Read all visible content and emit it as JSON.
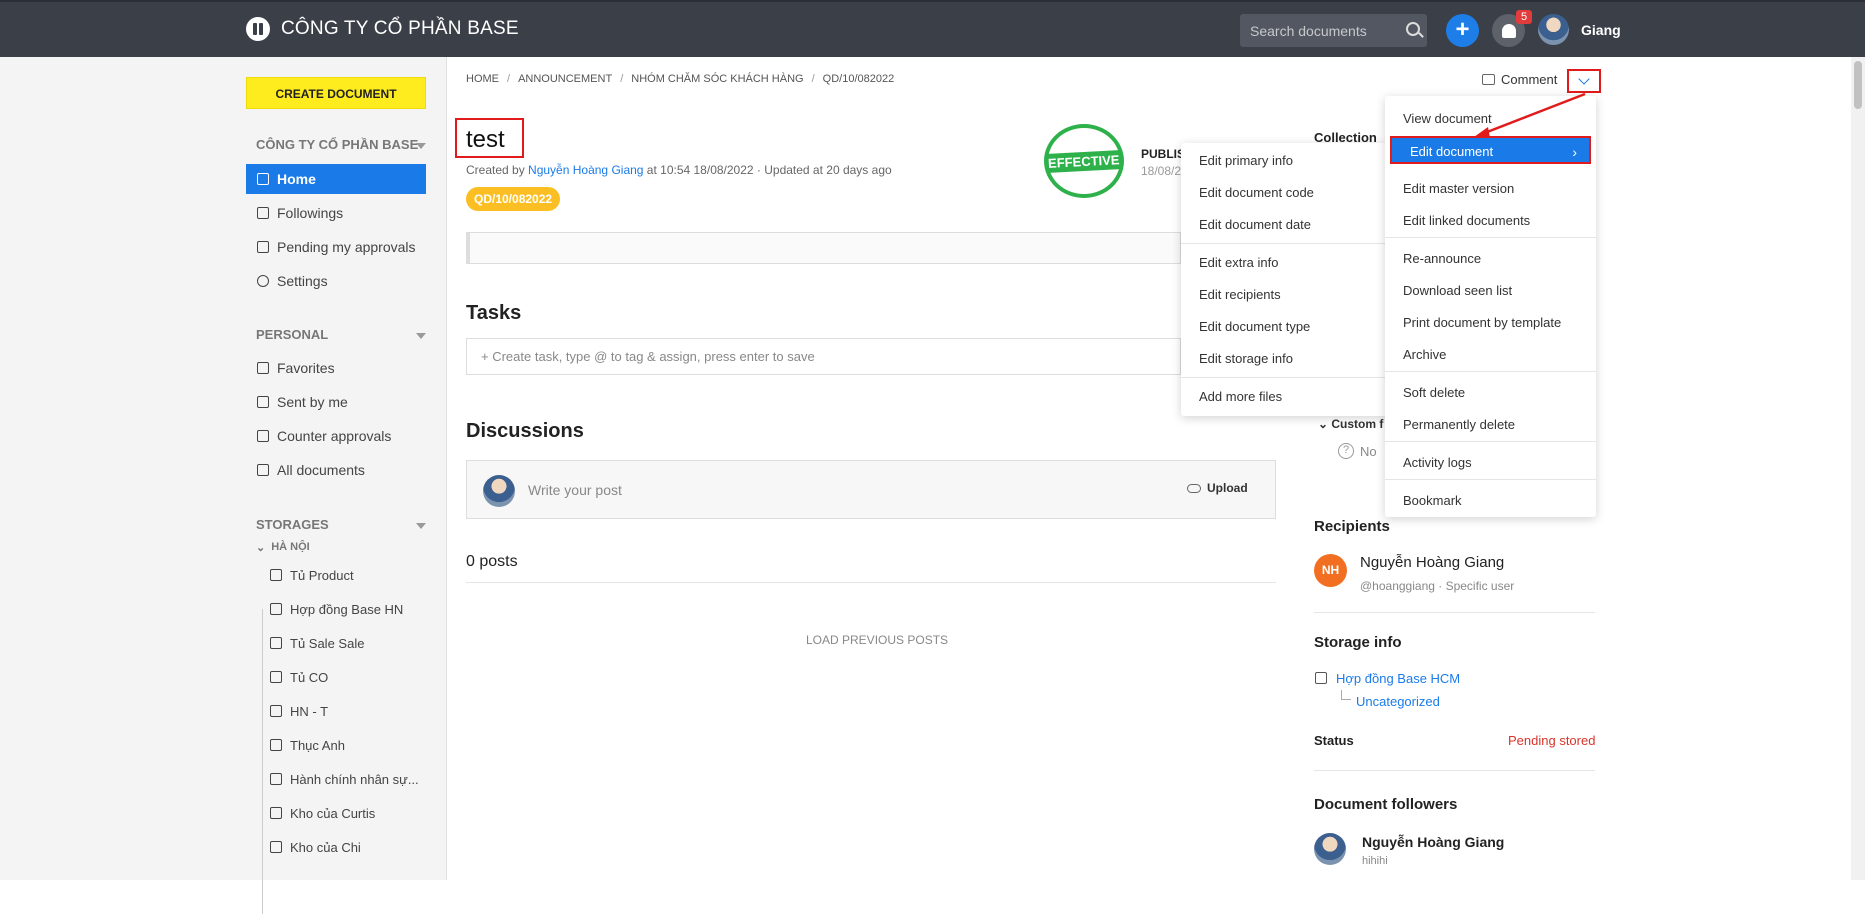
{
  "header": {
    "company": "CÔNG TY CỔ PHẦN BASE",
    "search_placeholder": "Search documents",
    "notification_count": "5",
    "user_name": "Giang"
  },
  "sidebar": {
    "create_label": "CREATE DOCUMENT",
    "company_section": "CÔNG TY CỔ PHẦN BASE",
    "main_items": [
      "Home",
      "Followings",
      "Pending my approvals",
      "Settings"
    ],
    "personal_section": "PERSONAL",
    "personal_items": [
      "Favorites",
      "Sent by me",
      "Counter approvals",
      "All documents"
    ],
    "storages_section": "STORAGES",
    "storage_group": "HÀ NỘI",
    "storage_items": [
      "Tủ Product",
      "Hợp đồng Base HN",
      "Tủ Sale Sale",
      "Tủ CO",
      "HN - T",
      "Thục Anh",
      "Hành chính nhân sự...",
      "Kho của Curtis",
      "Kho của Chi"
    ]
  },
  "breadcrumb": [
    "HOME",
    "ANNOUNCEMENT",
    "NHÓM CHĂM SÓC KHÁCH HÀNG",
    "QD/10/082022"
  ],
  "comment_label": "Comment",
  "document": {
    "title": "test",
    "created_prefix": "Created by ",
    "author": "Nguyễn Hoàng Giang",
    "created_suffix": " at 10:54 18/08/2022 · Updated at 20 days ago",
    "code": "QD/10/082022",
    "stamp_text": "EFFECTIVE",
    "published_label": "PUBLIS",
    "published_date": "18/08/2"
  },
  "tasks": {
    "heading": "Tasks",
    "placeholder": "Create task, type @ to tag & assign, press enter to save"
  },
  "discussions": {
    "heading": "Discussions",
    "placeholder": "Write your post",
    "upload_label": "Upload",
    "count": "0 posts",
    "load_previous": "LOAD PREVIOUS POSTS"
  },
  "right": {
    "collection_label": "Collection",
    "custom_label": "Custom f",
    "no_label": "No",
    "recipients_heading": "Recipients",
    "recipient_initials": "NH",
    "recipient_name": "Nguyễn Hoàng Giang",
    "recipient_sub": "@hoanggiang · Specific user",
    "storage_heading": "Storage info",
    "storage_name": "Hợp đồng Base HCM",
    "storage_sub": "Uncategorized",
    "status_label": "Status",
    "status_value": "Pending stored",
    "followers_heading": "Document followers",
    "follower_name": "Nguyễn Hoàng Giang",
    "follower_sub": "hihihi"
  },
  "main_menu": {
    "items": [
      "View document",
      "Edit document",
      "Edit master version",
      "Edit linked documents",
      "Re-announce",
      "Download seen list",
      "Print document by template",
      "Archive",
      "Soft delete",
      "Permanently delete",
      "Activity logs",
      "Bookmark"
    ]
  },
  "sub_menu": {
    "items": [
      "Edit primary info",
      "Edit document code",
      "Edit document date",
      "Edit extra info",
      "Edit recipients",
      "Edit document type",
      "Edit storage info",
      "Add more files"
    ]
  },
  "colors": {
    "topbar": "#3b3f48",
    "accent": "#1a7be8",
    "create_button": "#ffec1f",
    "annotation_red": "#e11b1b",
    "stamp_green": "#2eb14b"
  }
}
